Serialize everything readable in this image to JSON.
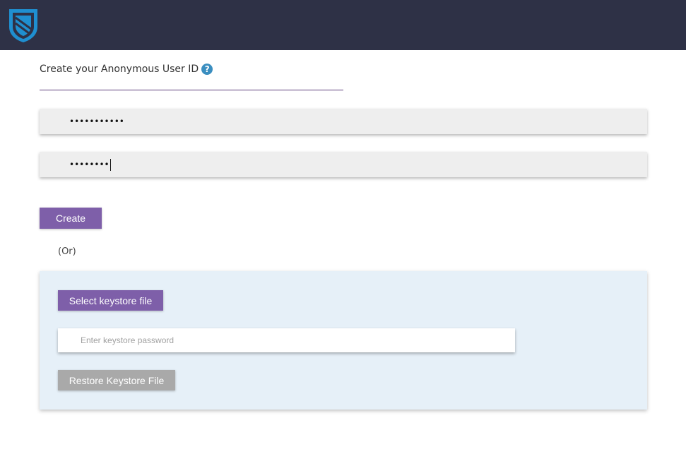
{
  "header": {
    "logo_icon": "shield-logo-icon",
    "background": "#2e3146"
  },
  "form": {
    "title": "Create your Anonymous User ID",
    "help_icon_label": "?",
    "password_value": "•••••••••••",
    "confirm_password_value": "••••••••",
    "create_label": "Create",
    "accent_color": "#7e5fa9"
  },
  "or_text": "(Or)",
  "keystore": {
    "select_label": "Select keystore file",
    "password_placeholder": "Enter keystore password",
    "restore_label": "Restore Keystore File",
    "panel_color": "#e6f0f8"
  }
}
